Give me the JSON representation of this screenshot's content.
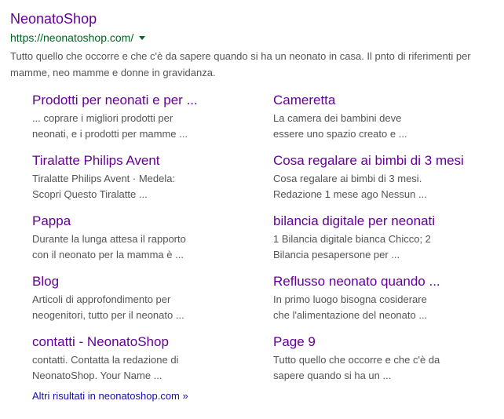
{
  "result": {
    "title": "NeonatoShop",
    "url": "https://neonatoshop.com/",
    "snippet": "Tutto quello che occorre e che c'è da sapere quando si ha un neonato in casa. Il pnto di riferimenti per mamme, neo mamme e donne in gravidanza."
  },
  "sitelinks": [
    {
      "title": "Prodotti per neonati e per ...",
      "desc1": "... coprare i migliori prodotti per",
      "desc2": "neonati, e i prodotti per mamme ..."
    },
    {
      "title": "Cameretta",
      "desc1": "La camera dei bambini deve",
      "desc2": "essere uno spazio creato e ..."
    },
    {
      "title": "Tiralatte Philips Avent",
      "desc1": "Tiralatte Philips Avent · Medela:",
      "desc2": "Scopri Questo Tiralatte ..."
    },
    {
      "title": "Cosa regalare ai bimbi di 3 mesi",
      "desc1": "Cosa regalare ai bimbi di 3 mesi.",
      "desc2": "Redazione 1 mese ago Nessun ..."
    },
    {
      "title": "Pappa",
      "desc1": "Durante la lunga attesa il rapporto",
      "desc2": "con il neonato per la mamma è ..."
    },
    {
      "title": "bilancia digitale per neonati",
      "desc1": "1 Bilancia digitale bianca Chicco; 2",
      "desc2": "Bilancia pesapersone per ..."
    },
    {
      "title": "Blog",
      "desc1": "Articoli di approfondimento per",
      "desc2": "neogenitori, tutto per il neonato ..."
    },
    {
      "title": "Reflusso neonato quando ...",
      "desc1": "In primo luogo bisogna cosiderare",
      "desc2": "che l'alimentazione del neonato ..."
    },
    {
      "title": "contatti - NeonatoShop",
      "desc1": "contatti. Contatta la redazione di",
      "desc2": "NeonatoShop. Your Name ..."
    },
    {
      "title": "Page 9",
      "desc1": "Tutto quello che occorre e che c'è da",
      "desc2": "sapere quando si ha un ..."
    }
  ],
  "more_results": "Altri risultati in neonatoshop.com »",
  "colors": {
    "visited_link": "#660099",
    "url_green": "#006621",
    "snippet_gray": "#545454",
    "link_blue": "#1a0dab"
  }
}
